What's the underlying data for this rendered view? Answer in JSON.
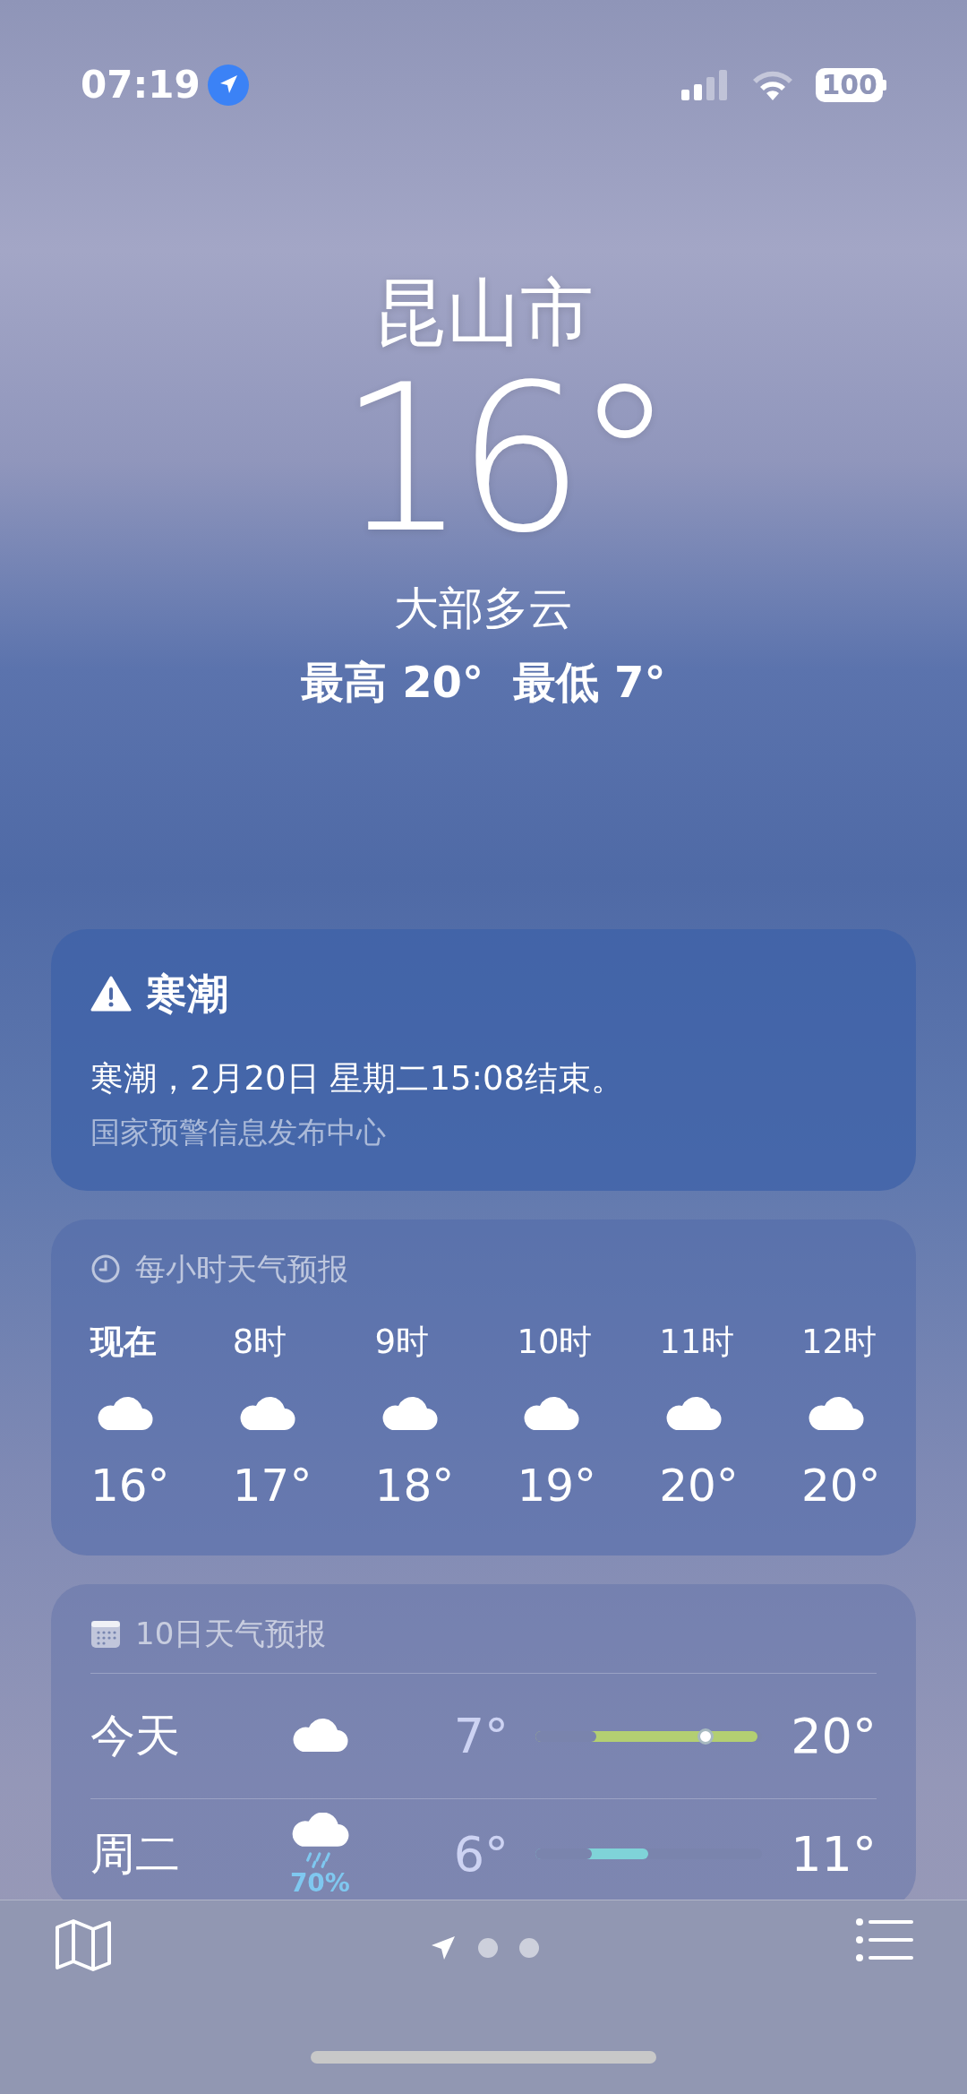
{
  "status_bar": {
    "time": "07:19",
    "location_active": true,
    "battery": "100"
  },
  "current": {
    "city": "昆山市",
    "temperature": "16°",
    "condition": "大部多云",
    "high_low": "最高 20°  最低 7°"
  },
  "alert": {
    "title": "寒潮",
    "message": "寒潮，2月20日 星期二15:08结束。",
    "source": "国家预警信息发布中心"
  },
  "hourly": {
    "title": "每小时天气预报",
    "items": [
      {
        "time": "现在",
        "kind": "cloudy",
        "temp": "16°",
        "selected": true
      },
      {
        "time": "8时",
        "kind": "cloudy",
        "temp": "17°",
        "selected": false
      },
      {
        "time": "9时",
        "kind": "cloudy",
        "temp": "18°",
        "selected": false
      },
      {
        "time": "10时",
        "kind": "cloudy",
        "temp": "19°",
        "selected": false
      },
      {
        "time": "11时",
        "kind": "cloudy",
        "temp": "20°",
        "selected": false
      },
      {
        "time": "12时",
        "kind": "cloudy",
        "temp": "20°",
        "selected": false
      }
    ]
  },
  "daily": {
    "title": "10日天气预报",
    "days": [
      {
        "day": "今天",
        "kind": "cloudy",
        "low": "7°",
        "high": "20°",
        "range_start": {
          "level": 0.27
        },
        "range_end": {
          "level": 0.98
        },
        "now_dot": {
          "level": 0.75
        },
        "color": "#b3cf72"
      },
      {
        "day": "周二",
        "kind": "rain",
        "chance": "70%",
        "low": "6°",
        "high": "11°",
        "range_start": {
          "level": 0.25
        },
        "range_end": {
          "level": 0.5
        },
        "color": "#7fd3d8"
      }
    ]
  },
  "toolbar": {
    "pages": [
      {
        "kind": "location",
        "selected": true
      },
      {
        "kind": "dot",
        "selected": false
      },
      {
        "kind": "dot",
        "selected": false
      }
    ]
  }
}
